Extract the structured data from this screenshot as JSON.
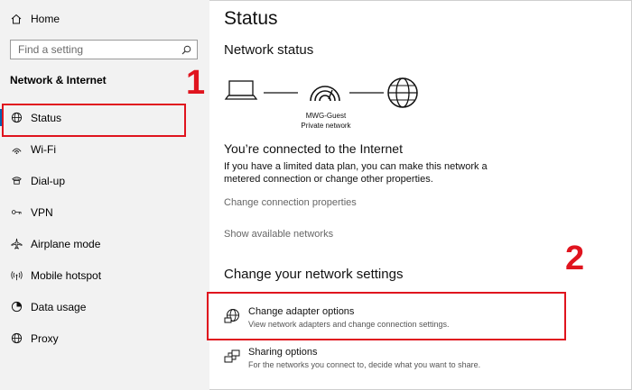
{
  "sidebar": {
    "home_label": "Home",
    "search_placeholder": "Find a setting",
    "section_title": "Network & Internet",
    "items": [
      {
        "label": "Status",
        "icon": "globe-status-icon"
      },
      {
        "label": "Wi-Fi",
        "icon": "wifi-icon"
      },
      {
        "label": "Dial-up",
        "icon": "phone-icon"
      },
      {
        "label": "VPN",
        "icon": "vpn-icon"
      },
      {
        "label": "Airplane mode",
        "icon": "airplane-icon"
      },
      {
        "label": "Mobile hotspot",
        "icon": "hotspot-icon"
      },
      {
        "label": "Data usage",
        "icon": "data-usage-icon"
      },
      {
        "label": "Proxy",
        "icon": "globe-icon"
      }
    ],
    "active_index": 0
  },
  "main": {
    "title": "Status",
    "network_status_heading": "Network status",
    "network_name": "MWG-Guest",
    "network_type": "Private network",
    "connected_heading": "You’re connected to the Internet",
    "connected_text": "If you have a limited data plan, you can make this network a metered connection or change other properties.",
    "link_change_properties": "Change connection properties",
    "link_show_networks": "Show available networks",
    "change_settings_heading": "Change your network settings",
    "options": [
      {
        "title": "Change adapter options",
        "subtitle": "View network adapters and change connection settings.",
        "icon": "adapter-icon"
      },
      {
        "title": "Sharing options",
        "subtitle": "For the networks you connect to, decide what you want to share.",
        "icon": "sharing-icon"
      }
    ]
  },
  "annotations": {
    "marker_1": "1",
    "marker_2": "2",
    "color": "#e0141e"
  },
  "colors": {
    "sidebar_bg": "#f2f2f2",
    "accent": "#0063b1",
    "link": "#666666"
  }
}
